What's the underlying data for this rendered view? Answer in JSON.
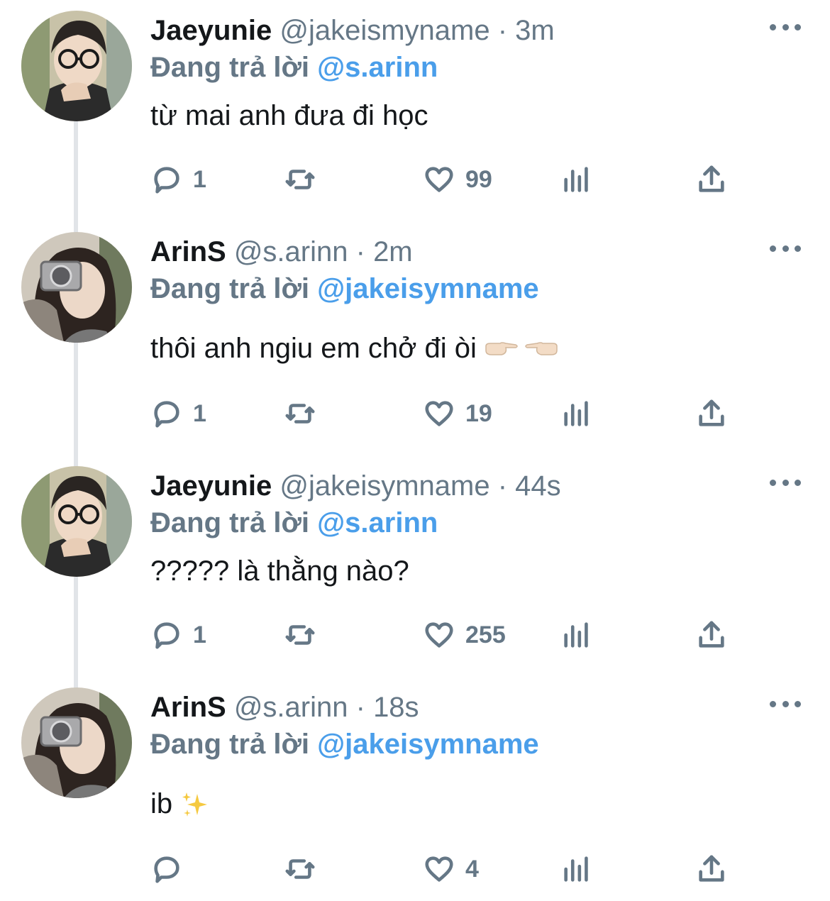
{
  "reply_prefix": "Đang trả lời",
  "colors": {
    "link": "#4a9eea",
    "muted": "#657786",
    "text": "#14171a",
    "thread_line": "#e1e4e8"
  },
  "tweets": [
    {
      "name": "Jaeyunie",
      "handle": "@jakeismyname",
      "separator": "·",
      "time": "3m",
      "reply_to": "@s.arinn",
      "text": "từ mai anh đưa đi học",
      "emoji": "",
      "avatar": "avatar-jaeyunie",
      "replies": "1",
      "likes": "99"
    },
    {
      "name": "ArinS",
      "handle": "@s.arinn",
      "separator": "·",
      "time": "2m",
      "reply_to": "@jakeisymname",
      "text": "thôi anh ngiu em chở đi òi",
      "emoji": "pointing-fingers-icon",
      "avatar": "avatar-arins",
      "replies": "1",
      "likes": "19"
    },
    {
      "name": "Jaeyunie",
      "handle": "@jakeisymname",
      "separator": "·",
      "time": "44s",
      "reply_to": "@s.arinn",
      "text": "????? là thằng nào?",
      "emoji": "",
      "avatar": "avatar-jaeyunie",
      "replies": "1",
      "likes": "255"
    },
    {
      "name": "ArinS",
      "handle": "@s.arinn",
      "separator": "·",
      "time": "18s",
      "reply_to": "@jakeisymname",
      "text": "ib",
      "emoji": "sparkles-icon",
      "avatar": "avatar-arins",
      "replies": "",
      "likes": "4"
    }
  ]
}
